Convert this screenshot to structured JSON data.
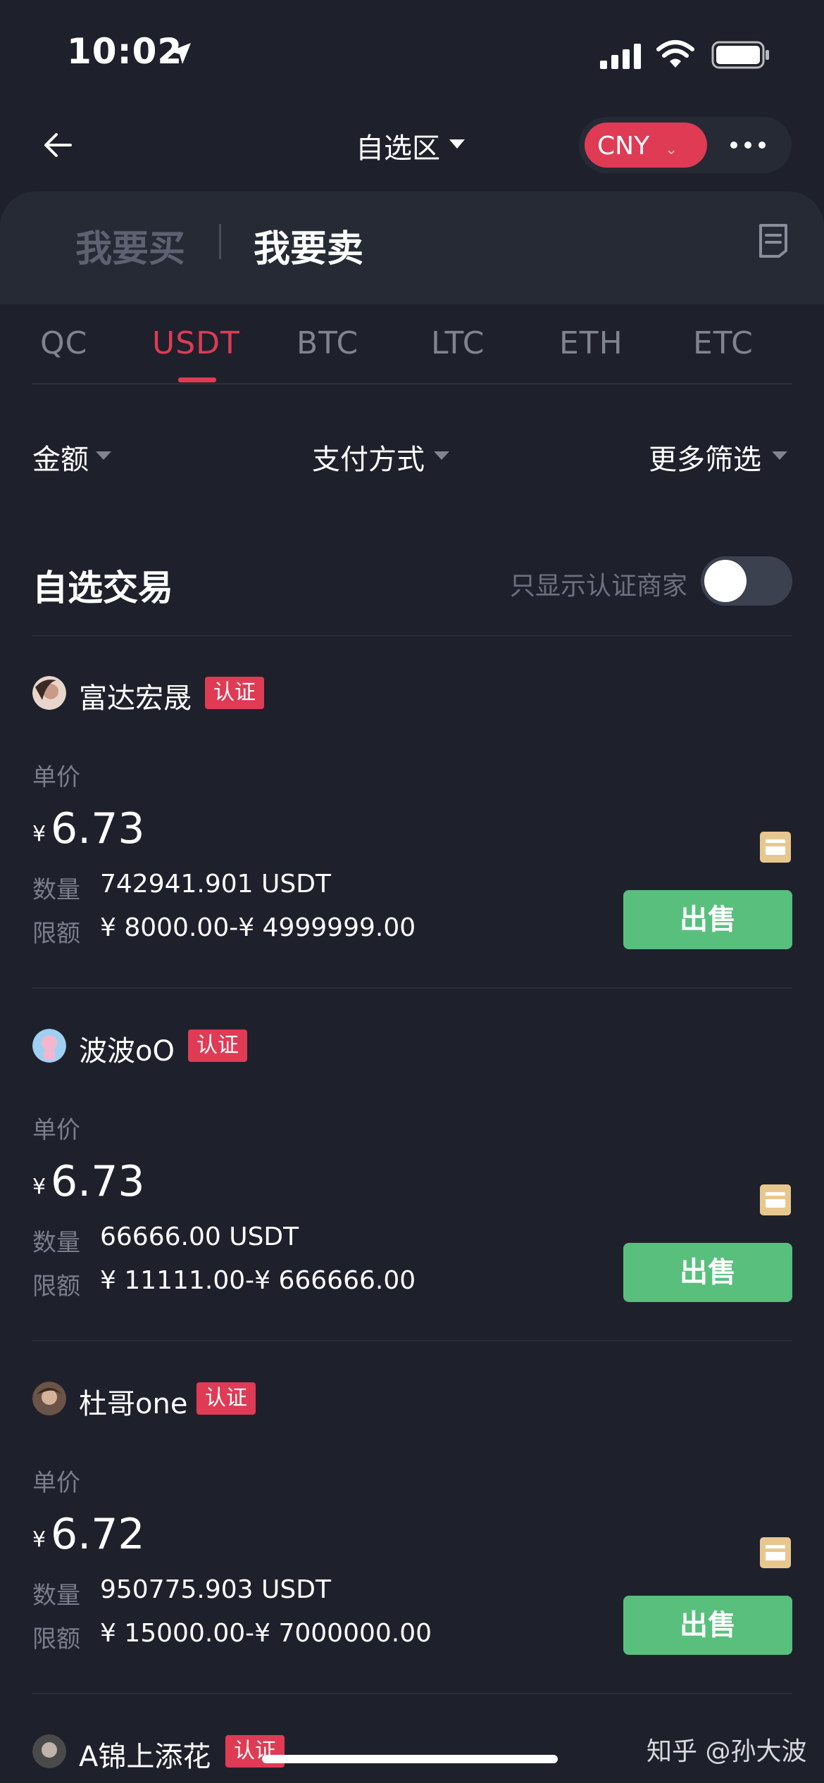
{
  "status": {
    "time": "10:02"
  },
  "nav": {
    "title": "自选区",
    "currency": "CNY"
  },
  "header_tabs": {
    "buy": "我要买",
    "sell": "我要卖"
  },
  "coins": [
    "QC",
    "USDT",
    "BTC",
    "LTC",
    "ETH",
    "ETC"
  ],
  "active_coin": "USDT",
  "filters": {
    "amount": "金额",
    "payment": "支付方式",
    "more": "更多筛选"
  },
  "section": {
    "title": "自选交易",
    "only_verified": "只显示认证商家",
    "only_verified_on": false
  },
  "labels": {
    "unit_price": "单价",
    "quantity": "数量",
    "limit": "限额",
    "verified": "认证",
    "sell": "出售",
    "yen": "¥"
  },
  "listings": [
    {
      "merchant": "富达宏晟",
      "price": "6.73",
      "quantity": "742941.901 USDT",
      "limit": "¥ 8000.00-¥ 4999999.00"
    },
    {
      "merchant": "波波oO",
      "price": "6.73",
      "quantity": "66666.00 USDT",
      "limit": "¥ 11111.00-¥ 666666.00"
    },
    {
      "merchant": "杜哥one",
      "price": "6.72",
      "quantity": "950775.903 USDT",
      "limit": "¥ 15000.00-¥ 7000000.00"
    },
    {
      "merchant": "A锦上添花"
    }
  ],
  "watermark": "知乎 @孙大波",
  "colors": {
    "background": "#1e212c",
    "accent": "#df3b55",
    "sell_button": "#58bf7d",
    "card_icon": "#e8c78f"
  }
}
